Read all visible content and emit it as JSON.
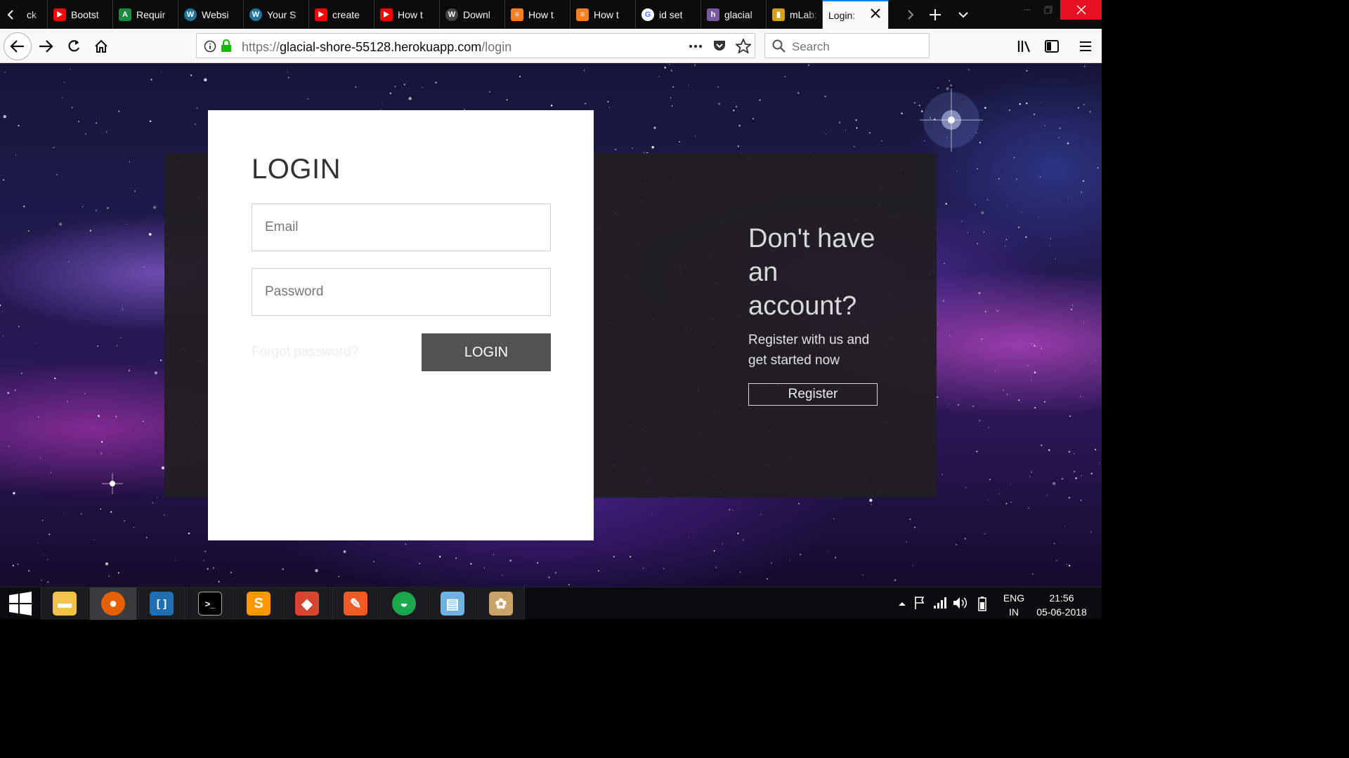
{
  "browser": {
    "tabs": [
      {
        "title": "ck",
        "icon": "partial-icon",
        "color": "#0c0c0d"
      },
      {
        "title": "Bootst",
        "icon": "youtube-icon",
        "color": "#ff0000"
      },
      {
        "title": "Requir",
        "icon": "android-studio-icon",
        "color": "#1d8b3e"
      },
      {
        "title": "Websi",
        "icon": "wordpress-icon",
        "color": "#21759b"
      },
      {
        "title": "Your S",
        "icon": "wordpress-icon",
        "color": "#21759b"
      },
      {
        "title": "create",
        "icon": "youtube-icon",
        "color": "#ff0000"
      },
      {
        "title": "How t",
        "icon": "youtube-icon",
        "color": "#ff0000"
      },
      {
        "title": "Downl",
        "icon": "wordpress-icon",
        "color": "#464646"
      },
      {
        "title": "How t",
        "icon": "stackoverflow-icon",
        "color": "#f48024"
      },
      {
        "title": "How t",
        "icon": "stackoverflow-icon",
        "color": "#f48024"
      },
      {
        "title": "id set",
        "icon": "google-icon",
        "color": "#ffffff"
      },
      {
        "title": "glacial",
        "icon": "heroku-icon",
        "color": "#79589f"
      },
      {
        "title": "mLab:",
        "icon": "mlab-icon",
        "color": "#d4a017"
      },
      {
        "title": "Login:",
        "icon": "",
        "color": "",
        "active": true
      }
    ],
    "url_prefix": "https://",
    "url_host": "glacial-shore-55128.herokuapp.com",
    "url_path": "/login",
    "search_placeholder": "Search"
  },
  "page": {
    "login_title": "LOGIN",
    "email_placeholder": "Email",
    "password_placeholder": "Password",
    "forgot_label": "Forgot password?",
    "login_button": "LOGIN",
    "register_heading": "Don't have an account?",
    "register_subtext": "Register with us and get started now",
    "register_button": "Register"
  },
  "taskbar": {
    "apps": [
      {
        "name": "file-explorer",
        "icon": "folder-icon",
        "color": "#f1c24c",
        "active": false
      },
      {
        "name": "firefox",
        "icon": "firefox-icon",
        "color": "#e66000",
        "active": true
      },
      {
        "name": "brackets",
        "icon": "brackets-icon",
        "color": "#1f6fb2",
        "active": false
      },
      {
        "name": "command-prompt",
        "icon": "terminal-icon",
        "color": "#000000",
        "active": false
      },
      {
        "name": "sublime-text",
        "icon": "sublime-icon",
        "color": "#ff9800",
        "active": false
      },
      {
        "name": "git-gui",
        "icon": "git-icon",
        "color": "#d6452f",
        "active": false
      },
      {
        "name": "postman",
        "icon": "postman-icon",
        "color": "#ef5b25",
        "active": false
      },
      {
        "name": "robomongo",
        "icon": "robomongo-icon",
        "color": "#1aa84d",
        "active": false
      },
      {
        "name": "notepad",
        "icon": "notepad-icon",
        "color": "#6fb1e0",
        "active": false
      },
      {
        "name": "paint",
        "icon": "paint-icon",
        "color": "#c8a36a",
        "active": false
      }
    ],
    "lang_line1": "ENG",
    "lang_line2": "IN",
    "time": "21:56",
    "date": "05-06-2018"
  }
}
